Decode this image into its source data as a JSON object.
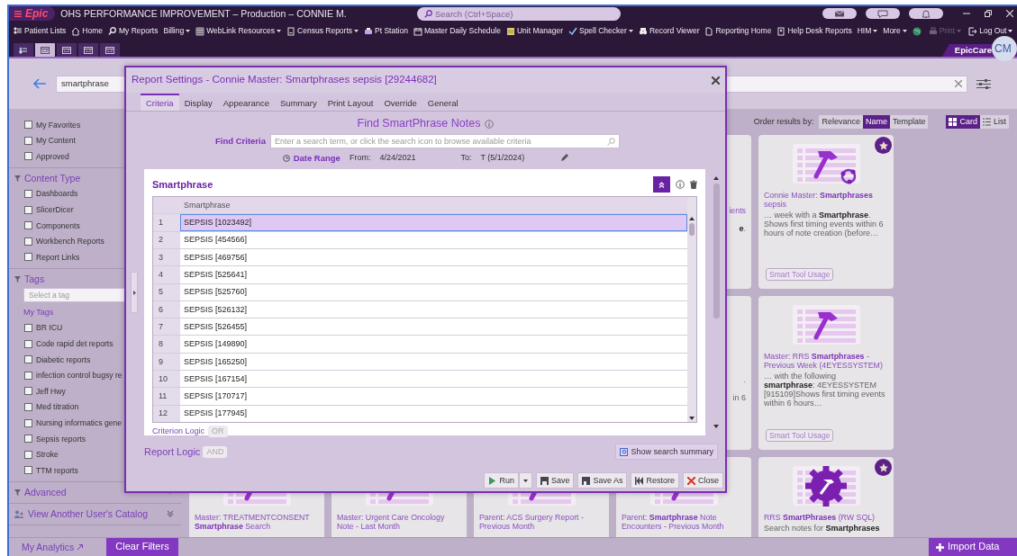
{
  "window": {
    "logo": "Epic",
    "title": "OHS PERFORMANCE IMPROVEMENT – Production – CONNIE M.",
    "search_placeholder": "Search (Ctrl+Space)"
  },
  "menu": [
    {
      "label": "Patient Lists",
      "dropdown": false
    },
    {
      "label": "Home",
      "dropdown": false
    },
    {
      "label": "My Reports",
      "dropdown": false
    },
    {
      "label": "Billing",
      "dropdown": true
    },
    {
      "label": "WebLink Resources",
      "dropdown": true
    },
    {
      "label": "Census Reports",
      "dropdown": true
    },
    {
      "label": "Pt Station",
      "dropdown": false
    },
    {
      "label": "Master Daily Schedule",
      "dropdown": false
    },
    {
      "label": "Unit Manager",
      "dropdown": false
    },
    {
      "label": "Spell Checker",
      "dropdown": true
    },
    {
      "label": "Record Viewer",
      "dropdown": false
    },
    {
      "label": "Reporting Home",
      "dropdown": false
    },
    {
      "label": "Help Desk Reports",
      "dropdown": false
    },
    {
      "label": "HIM",
      "dropdown": true
    },
    {
      "label": "More",
      "dropdown": true
    }
  ],
  "actions": [
    {
      "label": "Print",
      "disabled": true,
      "dropdown": true
    },
    {
      "label": "Log Out",
      "disabled": false,
      "dropdown": true
    }
  ],
  "activity_tabs": [
    {
      "selected": false
    },
    {
      "selected": true
    },
    {
      "selected": false
    },
    {
      "selected": false
    },
    {
      "selected": false
    }
  ],
  "app_badge": "EpicCare",
  "avatar": "CM",
  "header": {
    "search_value": "smartphrase"
  },
  "sidebar": {
    "quick_filters": [
      {
        "label": "My Favorites",
        "checked": false
      },
      {
        "label": "My Content",
        "checked": false
      },
      {
        "label": "Approved",
        "checked": false
      }
    ],
    "content_type": {
      "title": "Content Type",
      "items": [
        {
          "label": "Dashboards",
          "checked": false
        },
        {
          "label": "SlicerDicer",
          "checked": false
        },
        {
          "label": "Components",
          "checked": false
        },
        {
          "label": "Workbench Reports",
          "checked": false
        },
        {
          "label": "Report Links",
          "checked": false
        }
      ]
    },
    "tags": {
      "title": "Tags",
      "placeholder": "Select a tag",
      "subheading": "My Tags",
      "items": [
        {
          "label": "BR ICU",
          "checked": false
        },
        {
          "label": "Code rapid det reports",
          "checked": false
        },
        {
          "label": "Diabetic reports",
          "checked": false
        },
        {
          "label": "infection control bugsy re",
          "checked": false
        },
        {
          "label": "Jeff Hwy",
          "checked": false
        },
        {
          "label": "Med titration",
          "checked": false
        },
        {
          "label": "Nursing informatics gene",
          "checked": false
        },
        {
          "label": "Sepsis reports",
          "checked": false
        },
        {
          "label": "Stroke",
          "checked": false
        },
        {
          "label": "TTM reports",
          "checked": false
        }
      ]
    },
    "advanced": "Advanced",
    "other_catalog": "View Another User's Catalog"
  },
  "results": {
    "order_label": "Order results by:",
    "order": [
      {
        "label": "Relevance",
        "selected": false
      },
      {
        "label": "Name",
        "selected": true
      },
      {
        "label": "Template",
        "selected": false
      }
    ],
    "views": [
      {
        "label": "Card",
        "selected": true
      },
      {
        "label": "List",
        "selected": false
      }
    ],
    "cards": [
      {
        "kind": "partial",
        "title": "ients",
        "snippet": "**e**."
      },
      {
        "kind": "hammer-shared",
        "favorite": true,
        "title": "Connie Master: **Smartphrases** sepsis",
        "snippet": "… week with a **Smartphrase**. Shows first timing events within 6 hours of note creation (before…",
        "tag": "Smart Tool Usage"
      },
      {
        "kind": "partial",
        "title": ".",
        "snippet": "in 6"
      },
      {
        "kind": "hammer",
        "favorite": false,
        "title": "Master: RRS **Smartphrases** - Previous Week (4EYESSYSTEM)",
        "snippet": "… with the following **smartphrase**: 4EYESSYSTEM [915109]Shows first timing events within 6 hours…",
        "tag": "Smart Tool Usage"
      },
      {
        "kind": "hammer",
        "favorite": false,
        "title": "Master: TREATMENTCONSENT **Smartphrase** Search"
      },
      {
        "kind": "hammer",
        "favorite": false,
        "title": "Master: Urgent Care Oncology Note - Last Month"
      },
      {
        "kind": "hammer",
        "favorite": false,
        "title": "Parent: ACS Surgery Report - Previous Month"
      },
      {
        "kind": "hammer",
        "favorite": false,
        "title": "Parent: **Smartphrase** Note Encounters - Previous Month"
      },
      {
        "kind": "gear",
        "favorite": true,
        "title": "RRS **SmartPhrases** (RW SQL)",
        "snippet": "Search notes for **Smartphrases**"
      }
    ]
  },
  "footer": {
    "analytics": "My Analytics",
    "clear": "Clear Filters",
    "import": "Import Data"
  },
  "dialog": {
    "title": "Report Settings - Connie Master: Smartphrases sepsis [29244682]",
    "tabs": [
      {
        "label": "Criteria",
        "selected": true
      },
      {
        "label": "Display",
        "selected": false
      },
      {
        "label": "Appearance",
        "selected": false
      },
      {
        "label": "Summary",
        "selected": false
      },
      {
        "label": "Print Layout",
        "selected": false
      },
      {
        "label": "Override",
        "selected": false
      },
      {
        "label": "General",
        "selected": false
      }
    ],
    "heading": "Find SmartPhrase Notes",
    "find_label": "Find Criteria",
    "find_placeholder": "Enter a search term, or click the search icon to browse available criteria",
    "date_label": "Date Range",
    "from_label": "From:",
    "from": "4/24/2021",
    "to_label": "To:",
    "to": "T (5/1/2024)",
    "criterion": {
      "title": "Smartphrase",
      "column": "Smartphrase",
      "logic_label": "Criterion Logic",
      "logic": "OR",
      "rows": [
        {
          "number": "1",
          "value": "SEPSIS [1023492]",
          "selected": true
        },
        {
          "number": "2",
          "value": "SEPSIS [454566]",
          "selected": false
        },
        {
          "number": "3",
          "value": "SEPSIS [469756]",
          "selected": false
        },
        {
          "number": "4",
          "value": "SEPSIS [525641]",
          "selected": false
        },
        {
          "number": "5",
          "value": "SEPSIS [525760]",
          "selected": false
        },
        {
          "number": "6",
          "value": "SEPSIS [526132]",
          "selected": false
        },
        {
          "number": "7",
          "value": "SEPSIS [526455]",
          "selected": false
        },
        {
          "number": "8",
          "value": "SEPSIS [149890]",
          "selected": false
        },
        {
          "number": "9",
          "value": "SEPSIS [165250]",
          "selected": false
        },
        {
          "number": "10",
          "value": "SEPSIS [167154]",
          "selected": false
        },
        {
          "number": "11",
          "value": "SEPSIS [170717]",
          "selected": false
        },
        {
          "number": "12",
          "value": "SEPSIS [177945]",
          "selected": false
        }
      ]
    },
    "report_logic_label": "Report Logic",
    "report_logic": "AND",
    "summary_button": "Show search summary",
    "buttons": [
      {
        "kind": "run",
        "label": "Run"
      },
      {
        "kind": "save",
        "label": "Save"
      },
      {
        "kind": "saveas",
        "label": "Save As"
      },
      {
        "kind": "restore",
        "label": "Restore"
      },
      {
        "kind": "close",
        "label": "Close"
      }
    ]
  }
}
